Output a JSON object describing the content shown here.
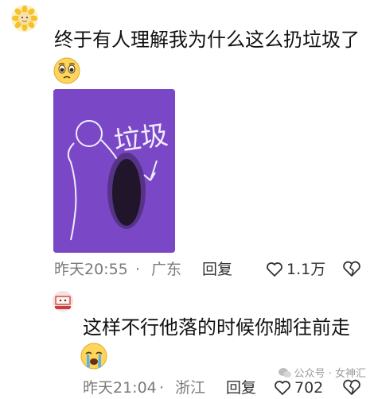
{
  "top_comment": {
    "text": "终于有人理解我为什么这么扔垃圾了",
    "emoji": "pleading-face-emoji",
    "image_description_icon": "stick-figure-drawing",
    "drawing_label": "垃圾",
    "time": "昨天20:55",
    "separator": "·",
    "location": "广东",
    "reply_label": "回复",
    "like_count": "1.1万"
  },
  "reply_comment": {
    "text": "这样不行他落的时候你脚往前走",
    "emoji": "crying-face-emoji",
    "time": "昨天21:04",
    "separator": "·",
    "location": "浙江",
    "reply_label": "回复",
    "like_count": "702"
  },
  "watermark": {
    "text": "公众号 · 女神汇"
  },
  "colors": {
    "drawing_bg": "#7a48c7",
    "meta_text": "#7a7a7a",
    "body_text": "#111111"
  }
}
